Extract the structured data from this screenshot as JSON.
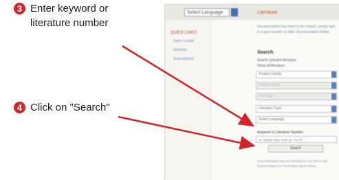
{
  "steps": [
    {
      "number": "3",
      "text": "Enter keyword or\nliterature number"
    },
    {
      "number": "4",
      "text": "Click on \"Search\""
    }
  ],
  "colors": {
    "badge": "#d2232a",
    "arrow": "#d2232a",
    "link": "#6e8fc0"
  },
  "screenshot": {
    "language_select": "Select Language",
    "sidebar": {
      "heading": "QUICK LINKS",
      "links": [
        "Sales Locator",
        "Websites",
        "Subscriptions"
      ]
    },
    "title": "Literature",
    "intro": "Documentation has been to the search, simply type or a part number or other documentation below.",
    "search_heading": "Search",
    "options": [
      "Search selected literature",
      "Show all literature"
    ],
    "selects": [
      "Product Family",
      "Product Class",
      "Part Type",
      "Literature Type",
      "Select Language"
    ],
    "keyword_label": "Keyword or Literature Number",
    "keyword_placeholder": "ex. partial entry, such as \"ALAN\"...",
    "search_button": "Search",
    "note": "Some literature may not reached be visit this to ask documentation for information about others."
  }
}
